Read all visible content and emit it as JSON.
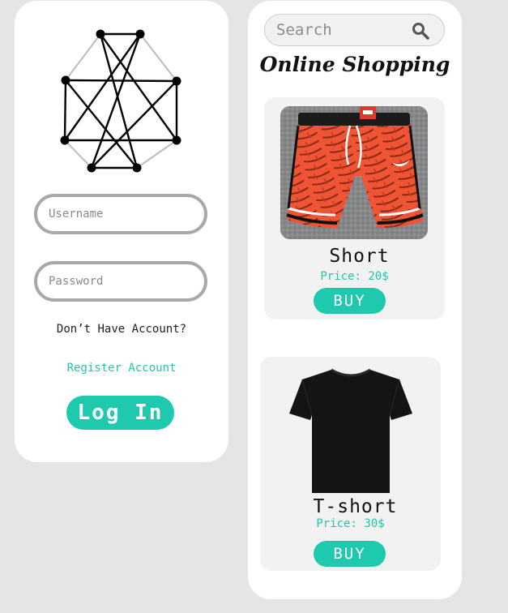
{
  "colors": {
    "background": "#e5e5e5",
    "card": "#ffffff",
    "accent": "#1ec9ae",
    "link": "#1fc7a8",
    "product_card": "#f2f2f2"
  },
  "login": {
    "logo_icon": "octagon-graph-logo",
    "username_placeholder": "Username",
    "password_placeholder": "Password",
    "no_account_text": "Don’t Have Account?",
    "register_link": "Register Account",
    "login_button": "Log In"
  },
  "shop": {
    "search_placeholder": "Search",
    "search_icon": "search-icon",
    "title": "Online Shopping",
    "products": [
      {
        "name": "Short",
        "price": "Price: 20$",
        "buy_label": "BUY",
        "image": "orange-tropical-print-shorts"
      },
      {
        "name": "T-short",
        "price": "Price: 30$",
        "buy_label": "BUY",
        "image": "black-t-shirt"
      }
    ]
  }
}
